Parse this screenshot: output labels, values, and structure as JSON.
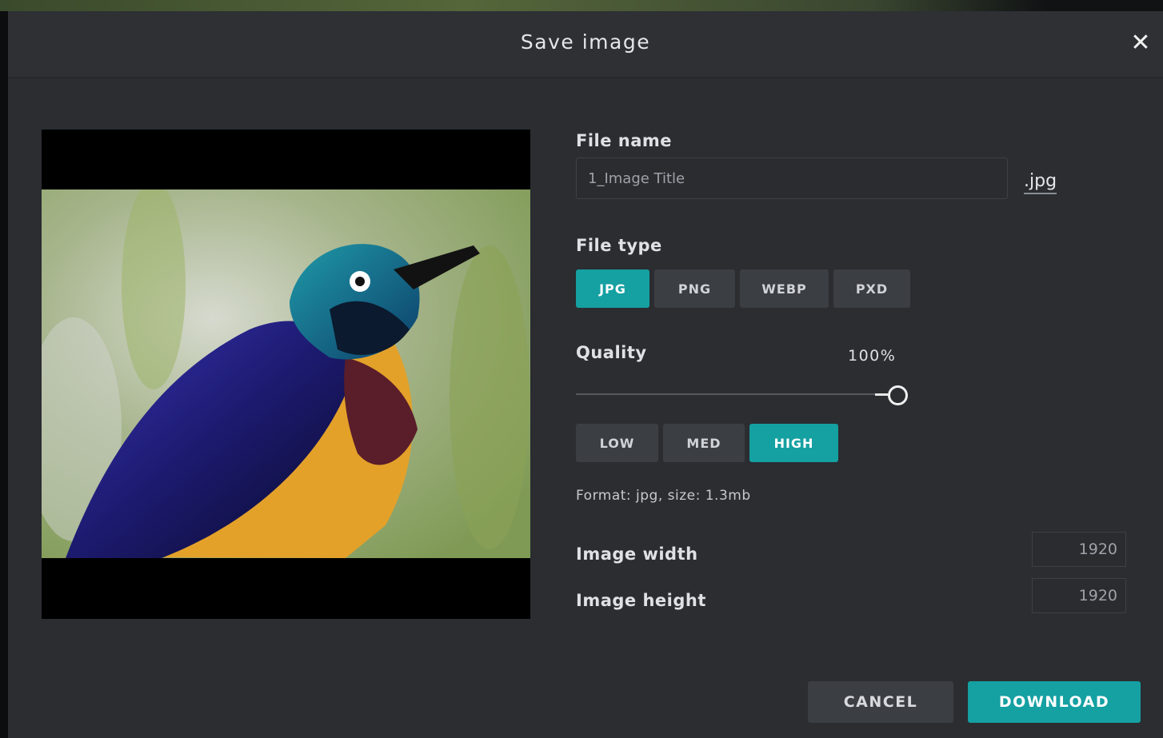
{
  "dialog": {
    "title": "Save image",
    "close_icon": "✕"
  },
  "file_name": {
    "label": "File name",
    "placeholder": "1_Image Title",
    "extension": ".jpg"
  },
  "file_type": {
    "label": "File type",
    "options": [
      "JPG",
      "PNG",
      "WEBP",
      "PXD"
    ],
    "selected": "JPG"
  },
  "quality": {
    "label": "Quality",
    "value_text": "100%",
    "value": 1.0,
    "presets": [
      "LOW",
      "MED",
      "HIGH"
    ],
    "selected": "HIGH"
  },
  "format_info": "Format: jpg, size: 1.3mb",
  "dimensions": {
    "width_label": "Image width",
    "width_value": "1920",
    "height_label": "Image height",
    "height_value": "1920"
  },
  "actions": {
    "cancel": "CANCEL",
    "download": "DOWNLOAD"
  },
  "colors": {
    "accent": "#15a0a2",
    "dialog_bg": "#2b2d31",
    "button_bg": "#3b3e43"
  },
  "icons": {
    "close": "close-icon",
    "slider_handle": "slider-knob"
  }
}
